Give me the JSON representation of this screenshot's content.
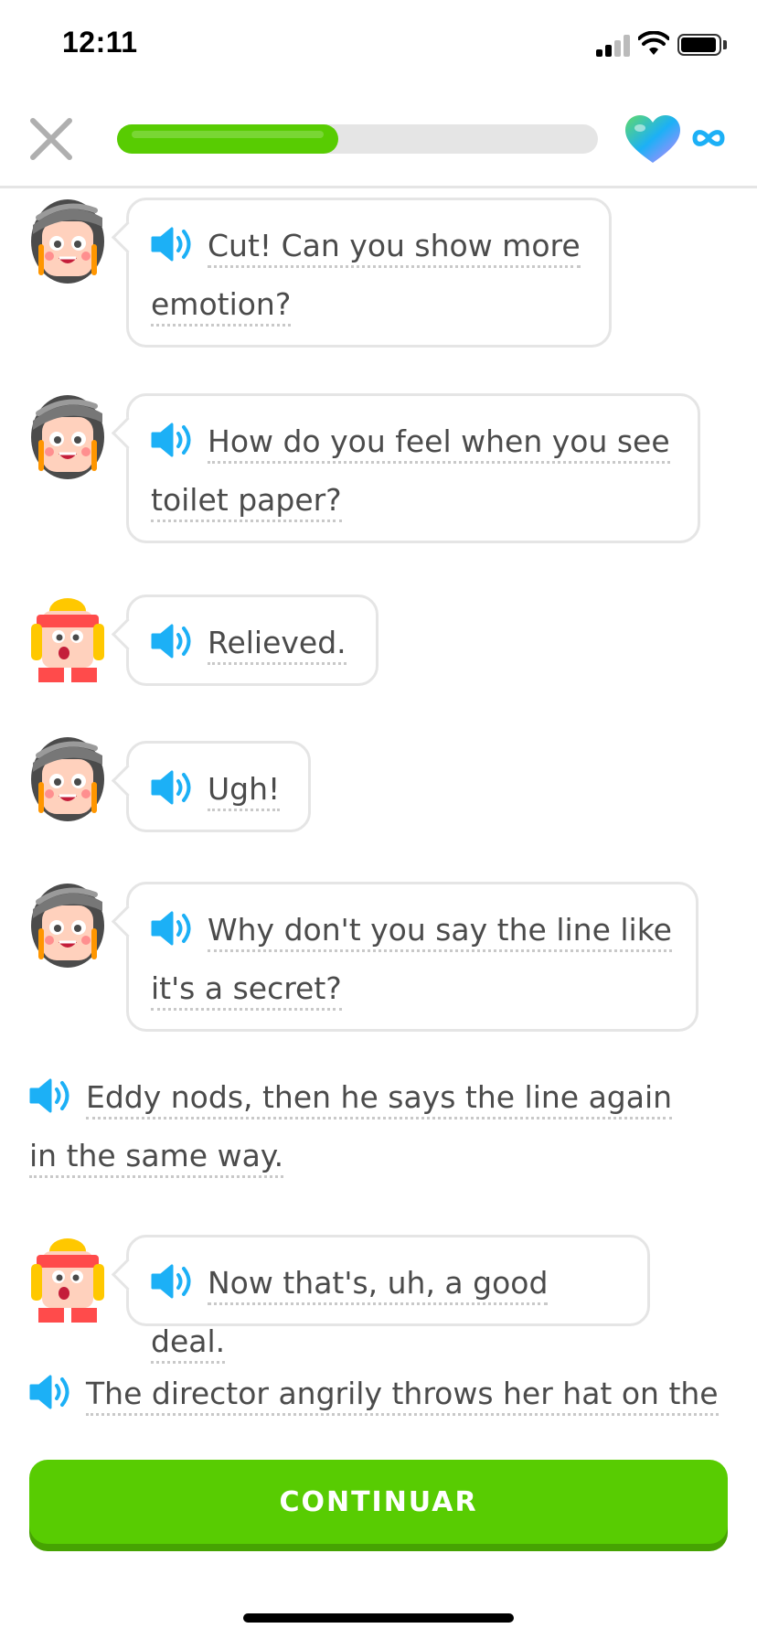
{
  "status_bar": {
    "time": "12:11"
  },
  "header": {
    "progress_fraction": 0.46,
    "hearts": "∞",
    "colors": {
      "progress": "#58cc02",
      "track": "#e5e5e5",
      "infinity": "#1cb0f6"
    }
  },
  "messages": [
    {
      "speaker": "director",
      "text": "Cut! Can you show more emotion?"
    },
    {
      "speaker": "director",
      "text": "How do you feel when you see toilet paper?"
    },
    {
      "speaker": "eddy",
      "text": "Relieved."
    },
    {
      "speaker": "director",
      "text": "Ugh!"
    },
    {
      "speaker": "director",
      "text": "Why don't you say the line like it's a secret?"
    },
    {
      "speaker": "narrator",
      "text": "Eddy nods, then he says the line again in the same way."
    },
    {
      "speaker": "eddy",
      "text": "Now that's, uh, a good deal."
    },
    {
      "speaker": "narrator",
      "text": "The director angrily throws her hat on the"
    }
  ],
  "continue_button": {
    "label": "CONTINUAR"
  }
}
